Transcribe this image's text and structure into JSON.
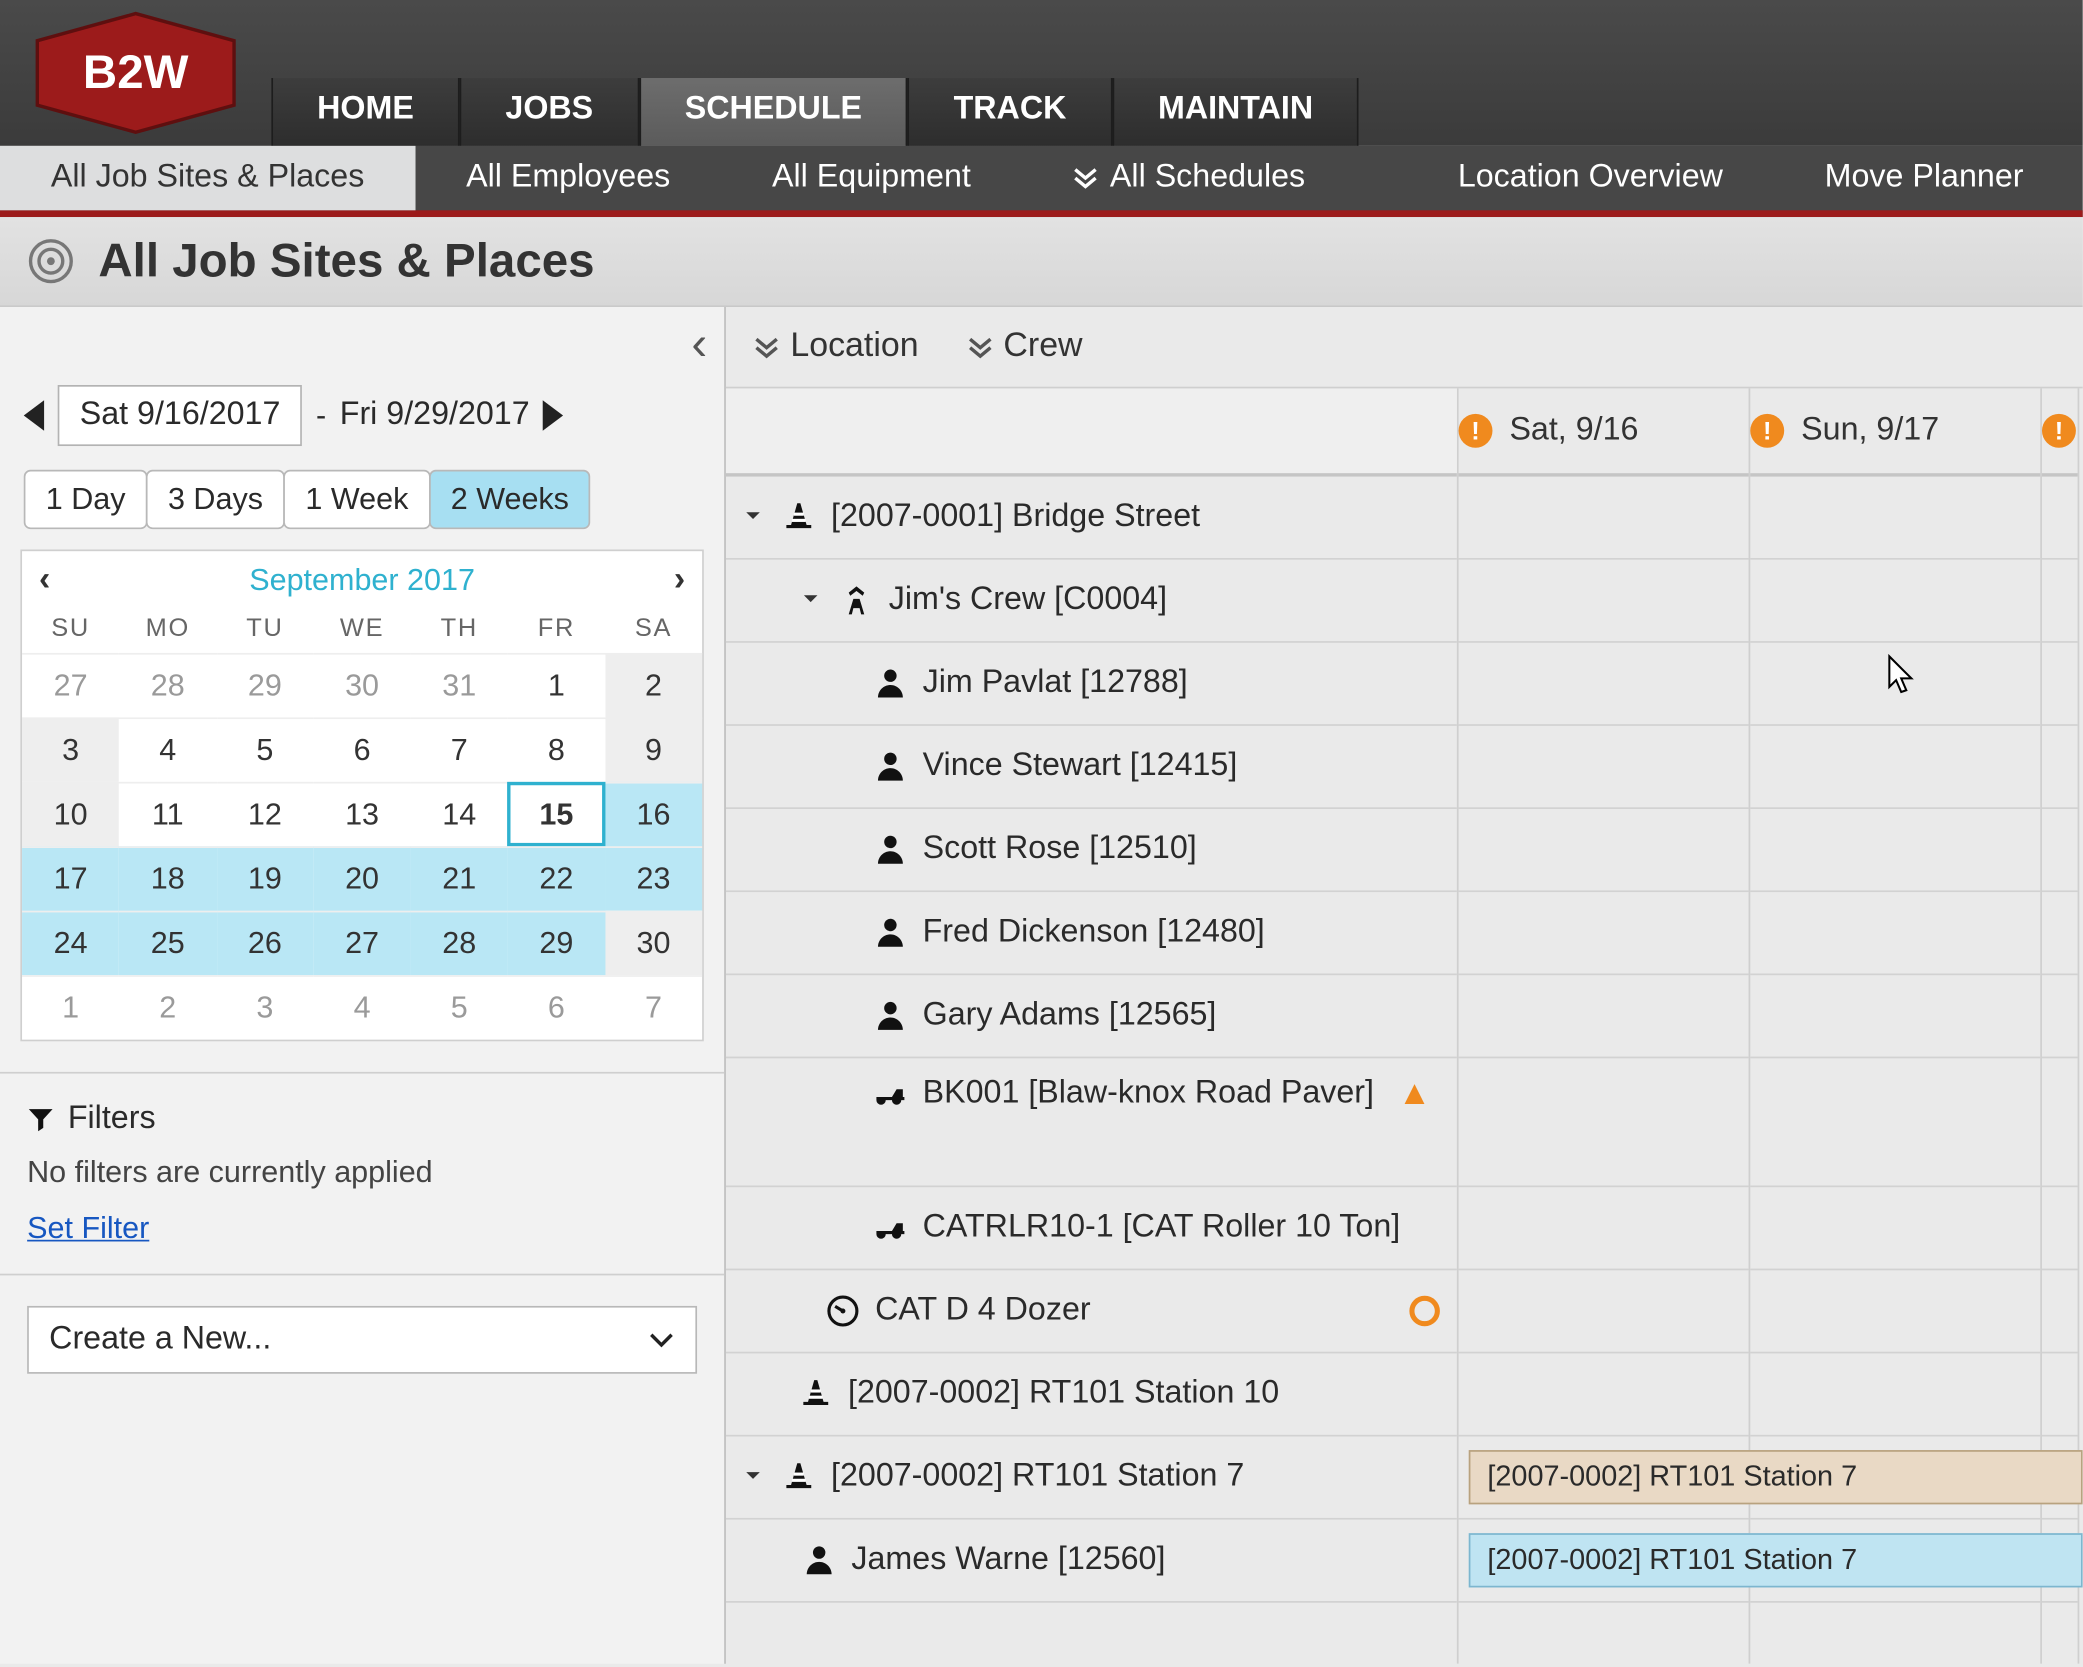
{
  "nav": {
    "tabs": [
      "HOME",
      "JOBS",
      "SCHEDULE",
      "TRACK",
      "MAINTAIN"
    ],
    "active": "SCHEDULE",
    "sub": {
      "items": [
        "All Job Sites & Places",
        "All Employees",
        "All Equipment",
        "All Schedules",
        "Location Overview",
        "Move Planner"
      ],
      "active": "All Job Sites & Places",
      "dropdown_index": 3
    }
  },
  "page": {
    "title": "All Job Sites & Places"
  },
  "sidebar": {
    "range": {
      "start": "Sat 9/16/2017",
      "end": "Fri 9/29/2017"
    },
    "zoom": {
      "options": [
        "1 Day",
        "3 Days",
        "1 Week",
        "2 Weeks"
      ],
      "active": "2 Weeks"
    },
    "calendar": {
      "month_label": "September 2017",
      "dow": [
        "SU",
        "MO",
        "TU",
        "WE",
        "TH",
        "FR",
        "SA"
      ],
      "days": [
        {
          "d": 27,
          "other": true
        },
        {
          "d": 28,
          "other": true
        },
        {
          "d": 29,
          "other": true
        },
        {
          "d": 30,
          "other": true
        },
        {
          "d": 31,
          "other": true
        },
        {
          "d": 1
        },
        {
          "d": 2,
          "shade": true
        },
        {
          "d": 3,
          "shade": true
        },
        {
          "d": 4
        },
        {
          "d": 5
        },
        {
          "d": 6
        },
        {
          "d": 7
        },
        {
          "d": 8
        },
        {
          "d": 9,
          "shade": true
        },
        {
          "d": 10,
          "shade": true
        },
        {
          "d": 11
        },
        {
          "d": 12
        },
        {
          "d": 13
        },
        {
          "d": 14
        },
        {
          "d": 15,
          "today": true
        },
        {
          "d": 16,
          "sel": true
        },
        {
          "d": 17,
          "sel": true
        },
        {
          "d": 18,
          "sel": true
        },
        {
          "d": 19,
          "sel": true
        },
        {
          "d": 20,
          "sel": true
        },
        {
          "d": 21,
          "sel": true
        },
        {
          "d": 22,
          "sel": true
        },
        {
          "d": 23,
          "sel": true
        },
        {
          "d": 24,
          "sel": true
        },
        {
          "d": 25,
          "sel": true
        },
        {
          "d": 26,
          "sel": true
        },
        {
          "d": 27,
          "sel": true
        },
        {
          "d": 28,
          "sel": true
        },
        {
          "d": 29,
          "sel": true
        },
        {
          "d": 30,
          "shade": true
        },
        {
          "d": 1,
          "other": true
        },
        {
          "d": 2,
          "other": true
        },
        {
          "d": 3,
          "other": true
        },
        {
          "d": 4,
          "other": true
        },
        {
          "d": 5,
          "other": true
        },
        {
          "d": 6,
          "other": true
        },
        {
          "d": 7,
          "other": true
        }
      ]
    },
    "filters": {
      "title": "Filters",
      "none": "No filters are currently applied",
      "set": "Set Filter"
    },
    "create": {
      "placeholder": "Create a New..."
    }
  },
  "main": {
    "filter_bar": {
      "location": "Location",
      "crew": "Crew"
    },
    "days": [
      {
        "label": "Sat, 9/16",
        "warn": true
      },
      {
        "label": "Sun, 9/17",
        "warn": true
      }
    ],
    "tree": [
      {
        "kind": "site",
        "icon": "cone",
        "label": "[2007-0001] Bridge Street",
        "caret": "open",
        "indent": 0
      },
      {
        "kind": "crew",
        "icon": "worker",
        "label": "Jim's Crew [C0004]",
        "caret": "open",
        "indent": 1
      },
      {
        "kind": "person",
        "icon": "person",
        "label": "Jim Pavlat [12788]",
        "indent": 2
      },
      {
        "kind": "person",
        "icon": "person",
        "label": "Vince Stewart [12415]",
        "indent": 2
      },
      {
        "kind": "person",
        "icon": "person",
        "label": "Scott Rose [12510]",
        "indent": 2
      },
      {
        "kind": "person",
        "icon": "person",
        "label": "Fred Dickenson [12480]",
        "indent": 2
      },
      {
        "kind": "person",
        "icon": "person",
        "label": "Gary Adams [12565]",
        "indent": 2
      },
      {
        "kind": "equip",
        "icon": "equip",
        "label": "BK001 [Blaw-knox Road Paver]",
        "indent": 2,
        "warn": true,
        "tall": true
      },
      {
        "kind": "equip",
        "icon": "equip",
        "label": "CATRLR10-1 [CAT Roller 10 Ton]",
        "indent": 2
      },
      {
        "kind": "equip",
        "icon": "gauge",
        "label": "CAT D 4 Dozer",
        "indent": 2,
        "circle": true,
        "gaugeindent": true
      },
      {
        "kind": "site",
        "icon": "cone",
        "label": "[2007-0002] RT101 Station 10",
        "indent": 0,
        "nocaret": true
      },
      {
        "kind": "site",
        "icon": "cone",
        "label": "[2007-0002] RT101 Station 7",
        "caret": "open",
        "indent": 0,
        "bars": [
          {
            "style": "peach",
            "text": "[2007-0002] RT101 Station 7"
          }
        ]
      },
      {
        "kind": "person",
        "icon": "person",
        "label": "James Warne [12560]",
        "indent": 1,
        "bars": [
          {
            "style": "blue",
            "text": "[2007-0002] RT101 Station 7"
          }
        ]
      }
    ]
  }
}
